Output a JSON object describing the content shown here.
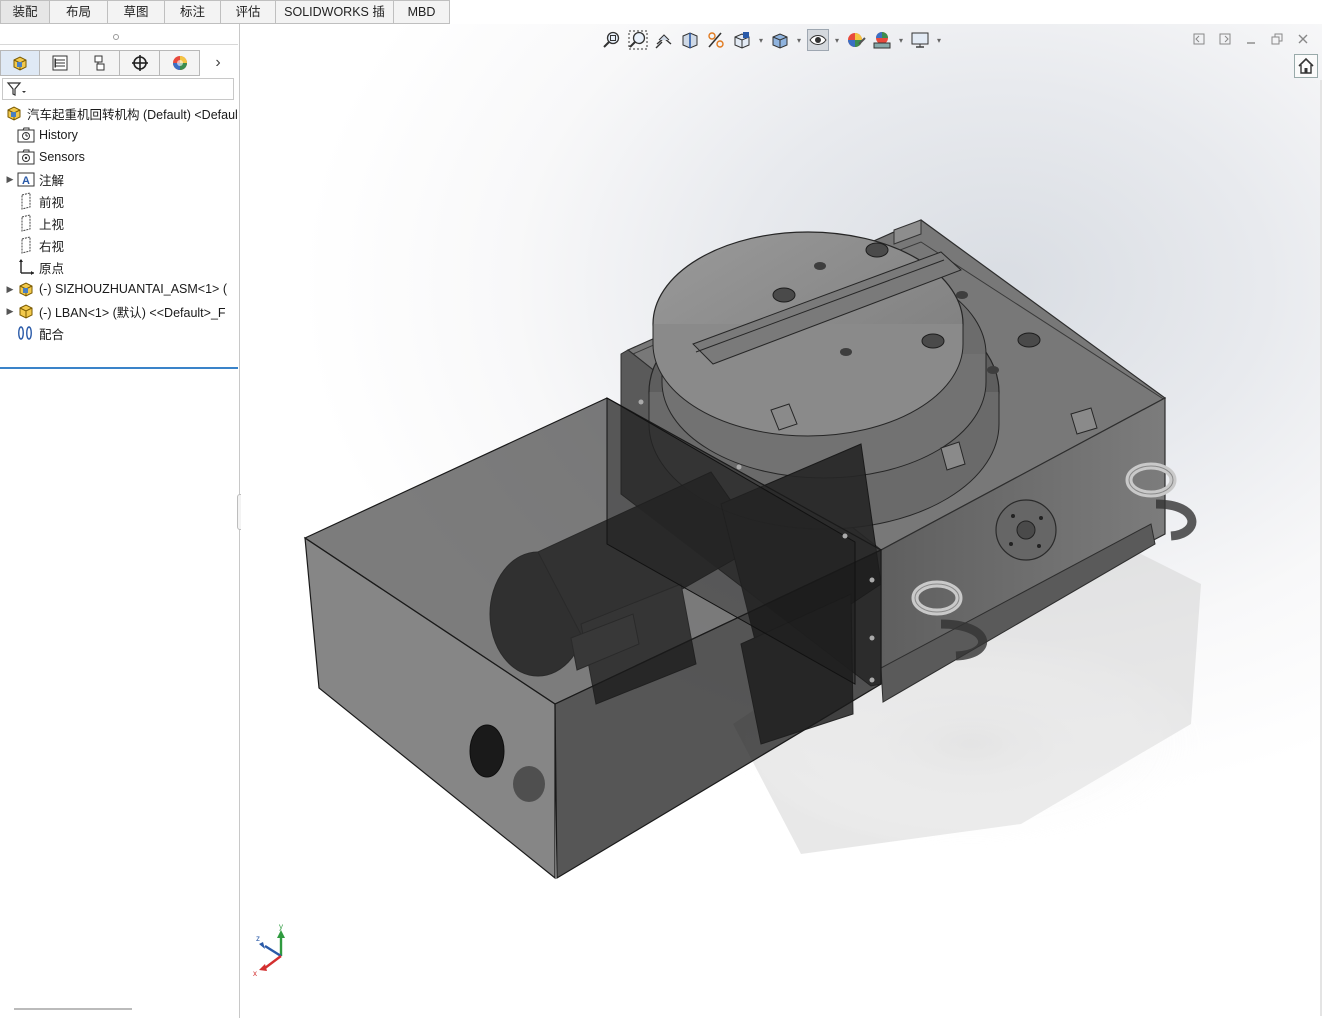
{
  "tabs": [
    "装配体",
    "布局",
    "草图",
    "标注",
    "评估",
    "SOLIDWORKS 插件",
    "MBD"
  ],
  "feature_manager": {
    "tab_icons": [
      "feature-manager-icon",
      "property-manager-icon",
      "configuration-manager-icon",
      "dimxpert-icon",
      "display-manager-icon"
    ],
    "more_label": "›",
    "tree": [
      {
        "label": "汽车起重机回转机构 (Default) <Default",
        "icon": "assembly-icon"
      },
      {
        "label": "History",
        "icon": "history-folder-icon"
      },
      {
        "label": "Sensors",
        "icon": "sensors-folder-icon"
      },
      {
        "label": "注解",
        "icon": "annotations-folder-icon"
      },
      {
        "label": "前视",
        "icon": "plane-icon"
      },
      {
        "label": "上视",
        "icon": "plane-icon"
      },
      {
        "label": "右视",
        "icon": "plane-icon"
      },
      {
        "label": "原点",
        "icon": "origin-icon"
      },
      {
        "label": "(-) SIZHOUZHUANTAI_ASM<1> (",
        "icon": "subassembly-icon"
      },
      {
        "label": "(-) LBAN<1> (默认) <<Default>_F",
        "icon": "part-icon"
      },
      {
        "label": "配合",
        "icon": "mates-icon"
      }
    ]
  },
  "hud_icons": [
    "zoom-to-fit-icon",
    "zoom-to-area-icon",
    "previous-view-icon",
    "section-view-icon",
    "dynamic-annotation-icon",
    "view-orientation-icon",
    "display-style-icon",
    "hide-show-items-icon",
    "edit-appearance-icon",
    "apply-scene-icon",
    "view-settings-icon"
  ],
  "triad_labels": {
    "x": "x",
    "y": "y",
    "z": "z"
  },
  "colors": {
    "accent": "#3a83c9",
    "body": "#6e6e6e",
    "enclosure": "#2b2b2b"
  }
}
